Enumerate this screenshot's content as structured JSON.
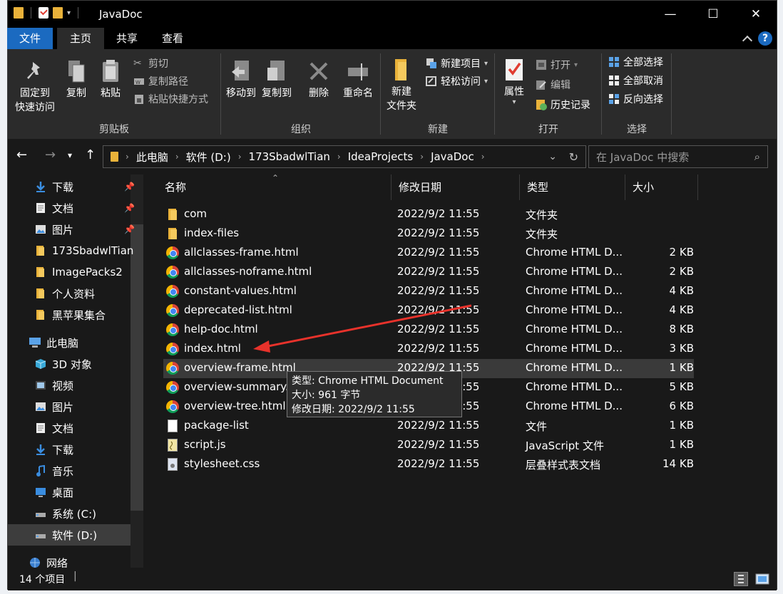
{
  "window": {
    "title": "JavaDoc",
    "minimize_glyph": "—",
    "maximize_glyph": "☐",
    "close_glyph": "✕"
  },
  "ribbon_tabs": {
    "file": "文件",
    "home": "主页",
    "share": "共享",
    "view": "查看"
  },
  "help_glyph": "?",
  "ribbon": {
    "clipboard": {
      "title": "剪贴板",
      "pin_line1": "固定到",
      "pin_line2": "快速访问",
      "copy": "复制",
      "paste": "粘贴",
      "cut": "剪切",
      "copy_path": "复制路径",
      "paste_shortcut": "粘贴快捷方式"
    },
    "organize": {
      "title": "组织",
      "move_to": "移动到",
      "copy_to": "复制到",
      "delete": "删除",
      "rename": "重命名"
    },
    "new": {
      "title": "新建",
      "new_folder_line1": "新建",
      "new_folder_line2": "文件夹",
      "new_item": "新建项目",
      "easy_access": "轻松访问"
    },
    "open": {
      "title": "打开",
      "properties": "属性",
      "open": "打开",
      "edit": "编辑",
      "history": "历史记录"
    },
    "select": {
      "title": "选择",
      "select_all": "全部选择",
      "select_none": "全部取消",
      "invert": "反向选择"
    }
  },
  "address": {
    "breadcrumbs": [
      "此电脑",
      "软件 (D:)",
      "173SbadwlTian",
      "IdeaProjects",
      "JavaDoc"
    ],
    "search_placeholder": "在 JavaDoc 中搜索"
  },
  "nav_pane": {
    "quick_access": [
      {
        "label": "下载",
        "icon": "download-icon",
        "pinned": true
      },
      {
        "label": "文档",
        "icon": "document-icon",
        "pinned": true
      },
      {
        "label": "图片",
        "icon": "picture-icon",
        "pinned": true
      },
      {
        "label": "173SbadwlTian",
        "icon": "folder-icon",
        "pinned": false
      },
      {
        "label": "ImagePacks2",
        "icon": "folder-icon",
        "pinned": false
      },
      {
        "label": "个人资料",
        "icon": "folder-icon",
        "pinned": false
      },
      {
        "label": "黑苹果集合",
        "icon": "folder-icon",
        "pinned": false
      }
    ],
    "this_pc": "此电脑",
    "pc_items": [
      {
        "label": "3D 对象",
        "icon": "cube-icon"
      },
      {
        "label": "视频",
        "icon": "video-icon"
      },
      {
        "label": "图片",
        "icon": "picture-icon"
      },
      {
        "label": "文档",
        "icon": "document-icon"
      },
      {
        "label": "下载",
        "icon": "download-icon"
      },
      {
        "label": "音乐",
        "icon": "music-icon"
      },
      {
        "label": "桌面",
        "icon": "desktop-icon"
      },
      {
        "label": "系统 (C:)",
        "icon": "drive-icon"
      },
      {
        "label": "软件 (D:)",
        "icon": "drive-icon"
      }
    ],
    "network": "网络"
  },
  "columns": {
    "name": "名称",
    "modified": "修改日期",
    "type": "类型",
    "size": "大小"
  },
  "files": [
    {
      "name": "com",
      "modified": "2022/9/2 11:55",
      "type": "文件夹",
      "size": "",
      "icon": "folder-icon"
    },
    {
      "name": "index-files",
      "modified": "2022/9/2 11:55",
      "type": "文件夹",
      "size": "",
      "icon": "folder-icon"
    },
    {
      "name": "allclasses-frame.html",
      "modified": "2022/9/2 11:55",
      "type": "Chrome HTML D...",
      "size": "2 KB",
      "icon": "chrome-icon"
    },
    {
      "name": "allclasses-noframe.html",
      "modified": "2022/9/2 11:55",
      "type": "Chrome HTML D...",
      "size": "2 KB",
      "icon": "chrome-icon"
    },
    {
      "name": "constant-values.html",
      "modified": "2022/9/2 11:55",
      "type": "Chrome HTML D...",
      "size": "4 KB",
      "icon": "chrome-icon"
    },
    {
      "name": "deprecated-list.html",
      "modified": "2022/9/2 11:55",
      "type": "Chrome HTML D...",
      "size": "4 KB",
      "icon": "chrome-icon"
    },
    {
      "name": "help-doc.html",
      "modified": "2022/9/2 11:55",
      "type": "Chrome HTML D...",
      "size": "8 KB",
      "icon": "chrome-icon"
    },
    {
      "name": "index.html",
      "modified": "2022/9/2 11:55",
      "type": "Chrome HTML D...",
      "size": "3 KB",
      "icon": "chrome-icon"
    },
    {
      "name": "overview-frame.html",
      "modified": "2022/9/2 11:55",
      "type": "Chrome HTML D...",
      "size": "1 KB",
      "icon": "chrome-icon"
    },
    {
      "name": "overview-summary.html",
      "modified": "2022/9/2 11:55",
      "type": "Chrome HTML D...",
      "size": "5 KB",
      "icon": "chrome-icon"
    },
    {
      "name": "overview-tree.html",
      "modified": "2022/9/2 11:55",
      "type": "Chrome HTML D...",
      "size": "6 KB",
      "icon": "chrome-icon"
    },
    {
      "name": "package-list",
      "modified": "2022/9/2 11:55",
      "type": "文件",
      "size": "1 KB",
      "icon": "file-icon"
    },
    {
      "name": "script.js",
      "modified": "2022/9/2 11:55",
      "type": "JavaScript 文件",
      "size": "1 KB",
      "icon": "js-file-icon"
    },
    {
      "name": "stylesheet.css",
      "modified": "2022/9/2 11:55",
      "type": "层叠样式表文档",
      "size": "14 KB",
      "icon": "css-file-icon"
    }
  ],
  "tooltip": {
    "line1": "类型: Chrome HTML Document",
    "line2": "大小: 961 字节",
    "line3": "修改日期: 2022/9/2 11:55"
  },
  "status": {
    "item_count": "14 个项目"
  },
  "colors": {
    "accent": "#1b6ac0",
    "arrow": "#e8322b",
    "folder": "#e9b23a"
  }
}
